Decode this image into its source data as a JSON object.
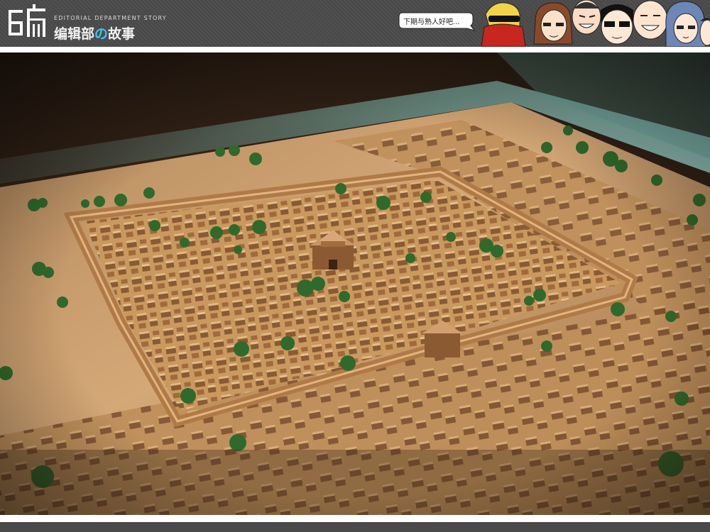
{
  "header": {
    "logo_char": "编",
    "tagline": "EDITORIAL DEPARTMENT STORY",
    "brand_part1": "编辑部",
    "brand_part2": "の",
    "brand_part3": "故事",
    "speech_bubble": "下期与熟人好吧..."
  },
  "photo": {
    "subject": "city-model",
    "icons": [
      "cartoon-face-icon"
    ]
  },
  "colors": {
    "header_bg": "#4a4a4a",
    "accent": "#3ec4ef",
    "model_tan": "#c89a62",
    "tree_green": "#2f6a2c"
  }
}
